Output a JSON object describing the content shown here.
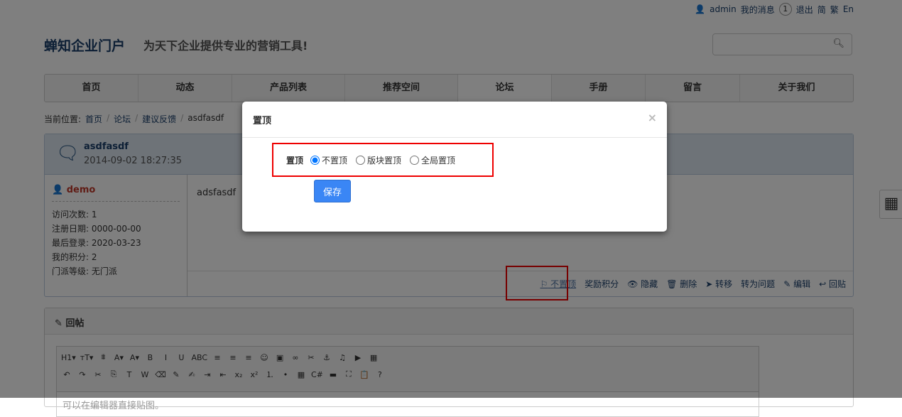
{
  "topbar": {
    "user": "admin",
    "messages": "我的消息",
    "message_count": "1",
    "logout": "退出",
    "simplified": "简",
    "traditional": "繁",
    "english": "En"
  },
  "header": {
    "logo": "蝉知企业门户",
    "slogan": "为天下企业提供专业的营销工具!",
    "search_placeholder": ""
  },
  "nav": [
    {
      "label": "首页"
    },
    {
      "label": "动态"
    },
    {
      "label": "产品列表"
    },
    {
      "label": "推荐空间"
    },
    {
      "label": "论坛",
      "active": true
    },
    {
      "label": "手册"
    },
    {
      "label": "留言"
    },
    {
      "label": "关于我们"
    }
  ],
  "breadcrumb": {
    "prefix": "当前位置:",
    "items": [
      "首页",
      "论坛",
      "建议反馈",
      "asdfasdf"
    ]
  },
  "post": {
    "title": "asdfasdf",
    "date": "2014-09-02 18:27:35",
    "content": "adsfasdf",
    "author": {
      "name": "demo",
      "visits": "访问次数: 1",
      "registered": "注册日期: 0000-00-00",
      "last_login": "最后登录: 2020-03-23",
      "points": "我的积分: 2",
      "level": "门派等级: 无门派"
    },
    "actions": {
      "unpin": "不置顶",
      "reward": "奖励积分",
      "hide": "隐藏",
      "delete": "删除",
      "move": "转移",
      "to_question": "转为问题",
      "edit": "编辑",
      "reply": "回贴"
    }
  },
  "reply": {
    "title": "回帖",
    "placeholder": "可以在编辑器直接贴图。",
    "toolbar_row1": [
      "H1▾",
      "тT▾",
      "⩩",
      "A▾",
      "A▾",
      "B",
      "I",
      "U",
      "ABC",
      "≡",
      "≡",
      "≡",
      "☺",
      "▣",
      "∞",
      "✂",
      "⚓",
      "♫",
      "▶",
      "▦"
    ],
    "toolbar_row2": [
      "↶",
      "↷",
      "✂",
      "⎘",
      "T",
      "W",
      "⌫",
      "✎",
      "✍",
      "⇥",
      "⇤",
      "x₂",
      "x²",
      "⒈",
      "•",
      "▦",
      "C#",
      "▬",
      "⛶",
      "📋",
      "?"
    ]
  },
  "modal": {
    "title": "置顶",
    "close": "×",
    "field_label": "置顶",
    "options": [
      "不置顶",
      "版块置顶",
      "全局置顶"
    ],
    "selected": 0,
    "save": "保存"
  },
  "colors": {
    "accent": "#3a86f5",
    "highlight": "#ee0000",
    "author": "#c0392b"
  }
}
